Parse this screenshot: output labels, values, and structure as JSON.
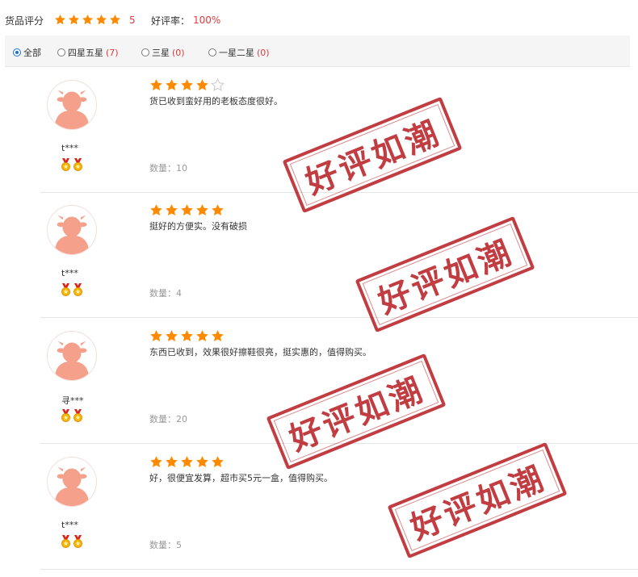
{
  "summary": {
    "rating_label": "货品评分",
    "rating_value": "5",
    "rating_stars": 5,
    "good_rate_label": "好评率：",
    "good_rate_value": "100%"
  },
  "filters": [
    {
      "label": "全部",
      "count": "",
      "checked": true
    },
    {
      "label": "四星五星",
      "count": "(7)",
      "checked": false
    },
    {
      "label": "三星",
      "count": "(0)",
      "checked": false
    },
    {
      "label": "一星二星",
      "count": "(0)",
      "checked": false
    }
  ],
  "reviews": [
    {
      "user": "t***",
      "stars": 4,
      "text": "货已收到蛮好用的老板态度很好。",
      "qty": "数量：10"
    },
    {
      "user": "t***",
      "stars": 5,
      "text": "挺好的方便实。没有破损",
      "qty": "数量：4"
    },
    {
      "user": "寻***",
      "stars": 5,
      "text": "东西已收到，效果很好擦鞋很亮，挺实惠的，值得购买。",
      "qty": "数量：20"
    },
    {
      "user": "t***",
      "stars": 5,
      "text": "好，很便宜发算，超市买5元一盒，值得购买。",
      "qty": "数量：5"
    }
  ],
  "stamp_text": "好评如潮",
  "colors": {
    "star": "#ff8a00",
    "accent": "#e4393c",
    "stamp": "#b81c22",
    "avatar": "#f5a08a"
  }
}
